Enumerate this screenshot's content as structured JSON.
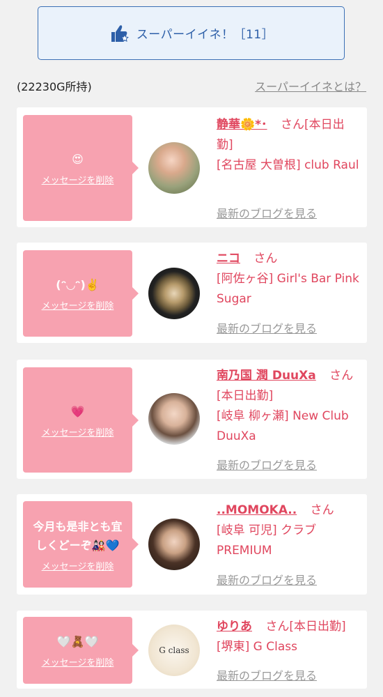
{
  "superlike": {
    "label": "スーパーイイネ！［11］"
  },
  "points_text": "(22230G所持)",
  "about_link": "スーパーイイネとは？",
  "cards": [
    {
      "message": "😍",
      "delete_label": "メッセージを削除",
      "name": "静華🌼*･",
      "san": "さん",
      "status": "[本日出勤]",
      "shop": "[名古屋 大曽根] club Raul",
      "blog": "最新のブログを見る"
    },
    {
      "message": "(ᵔ◡ᵔ)✌️",
      "delete_label": "メッセージを削除",
      "name": "ニコ",
      "san": "さん",
      "status": "",
      "shop": "[阿佐ヶ谷] Girl's Bar Pink Sugar",
      "blog": "最新のブログを見る"
    },
    {
      "message": "💗",
      "delete_label": "メッセージを削除",
      "name": "南乃国 潤 DuuXa",
      "san": "さん",
      "status": "[本日出勤]",
      "shop": "[岐阜 柳ヶ瀬] New Club DuuXa",
      "blog": "最新のブログを見る"
    },
    {
      "message": "今月も是非とも宜しくどーぞ🎎💙",
      "delete_label": "メッセージを削除",
      "name": "..MOMOKA..",
      "san": "さん",
      "status": "",
      "shop": "[岐阜 可児] クラブ PREMIUM",
      "blog": "最新のブログを見る"
    },
    {
      "message": "🤍🧸🤍",
      "delete_label": "メッセージを削除",
      "name": "ゆりあ",
      "san": "さん",
      "status": "[本日出勤]",
      "shop": "[堺東] G Class",
      "blog": "最新のブログを見る",
      "logo_text": "G class"
    }
  ]
}
